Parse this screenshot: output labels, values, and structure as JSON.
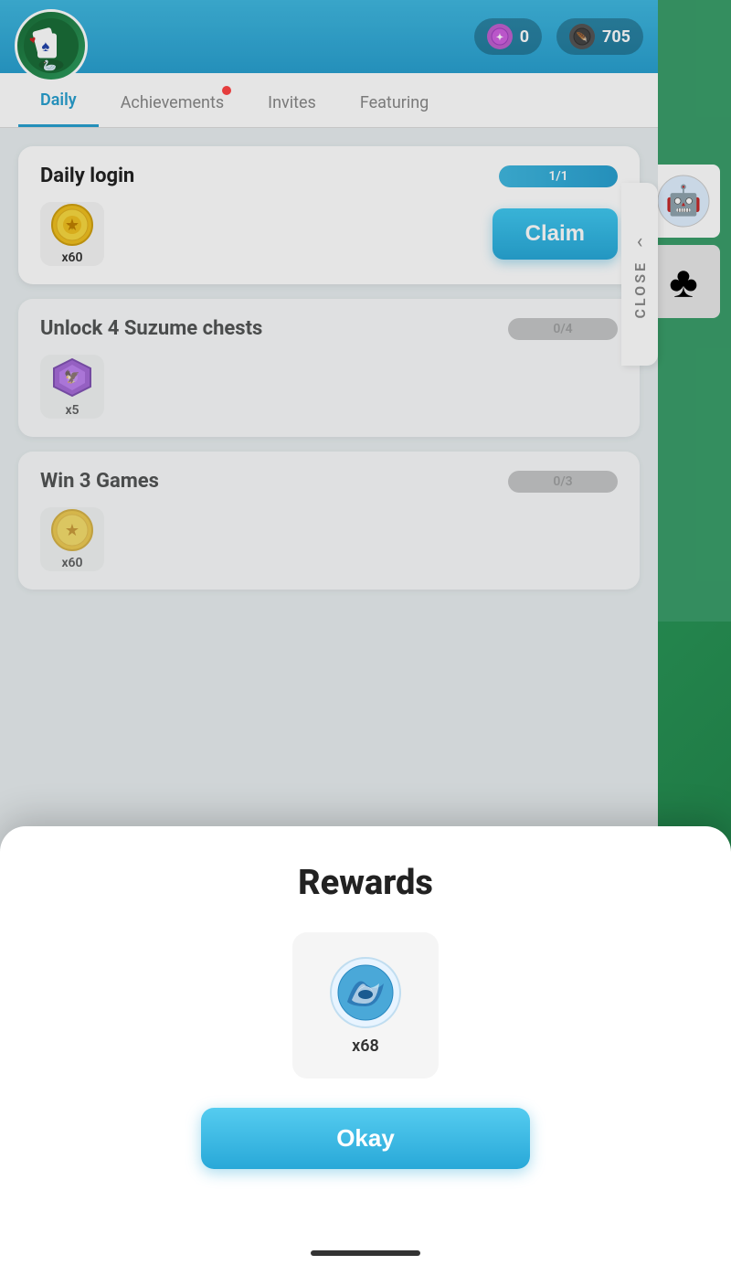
{
  "header": {
    "avatar_emoji": "🃏",
    "stats": [
      {
        "id": "coins",
        "icon": "🔮",
        "value": "0",
        "icon_bg": "#c060d0"
      },
      {
        "id": "score",
        "icon": "🪶",
        "value": "705",
        "icon_bg": "#555"
      }
    ]
  },
  "nav": {
    "tabs": [
      {
        "id": "daily",
        "label": "Daily",
        "active": true,
        "dot": false
      },
      {
        "id": "achievements",
        "label": "Achievements",
        "active": false,
        "dot": true
      },
      {
        "id": "invites",
        "label": "Invites",
        "active": false,
        "dot": false
      },
      {
        "id": "featuring",
        "label": "Featuring",
        "active": false,
        "dot": false
      }
    ]
  },
  "quests": [
    {
      "id": "daily-login",
      "title": "Daily login",
      "progress": "1/1",
      "progress_pct": 100,
      "reward_icon": "gold_coin",
      "reward_count": "x60",
      "claimable": true,
      "claim_label": "Claim"
    },
    {
      "id": "suzume-chests",
      "title": "Unlock 4 Suzume chests",
      "progress": "0/4",
      "progress_pct": 0,
      "reward_icon": "purple_gem",
      "reward_count": "x5",
      "claimable": false,
      "claim_label": ""
    },
    {
      "id": "win-games",
      "title": "Win 3 Games",
      "progress": "0/3",
      "progress_pct": 0,
      "reward_icon": "gold_coin",
      "reward_count": "x60",
      "claimable": false,
      "claim_label": ""
    }
  ],
  "close_panel": {
    "chevron": "‹",
    "label": "CLOSE"
  },
  "modal": {
    "title": "Rewards",
    "reward_icon": "blue_wing",
    "reward_count": "x68",
    "okay_label": "Okay"
  }
}
